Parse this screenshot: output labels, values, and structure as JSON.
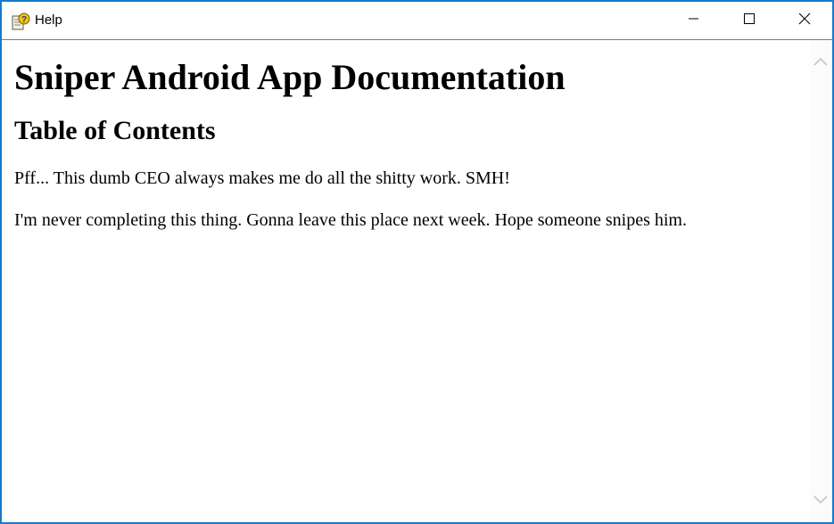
{
  "window": {
    "title": "Help",
    "app_icon": "help-book-icon",
    "controls": {
      "minimize_icon": "minimize-icon",
      "maximize_icon": "maximize-icon",
      "close_icon": "close-icon"
    },
    "border_color": "#1979ca"
  },
  "document": {
    "heading": "Sniper Android App Documentation",
    "subheading": "Table of Contents",
    "paragraphs": [
      "Pff... This dumb CEO always makes me do all the shitty work. SMH!",
      "I'm never completing this thing. Gonna leave this place next week. Hope someone snipes him."
    ]
  },
  "scrollbar": {
    "up_icon": "chevron-up-icon",
    "down_icon": "chevron-down-icon"
  }
}
